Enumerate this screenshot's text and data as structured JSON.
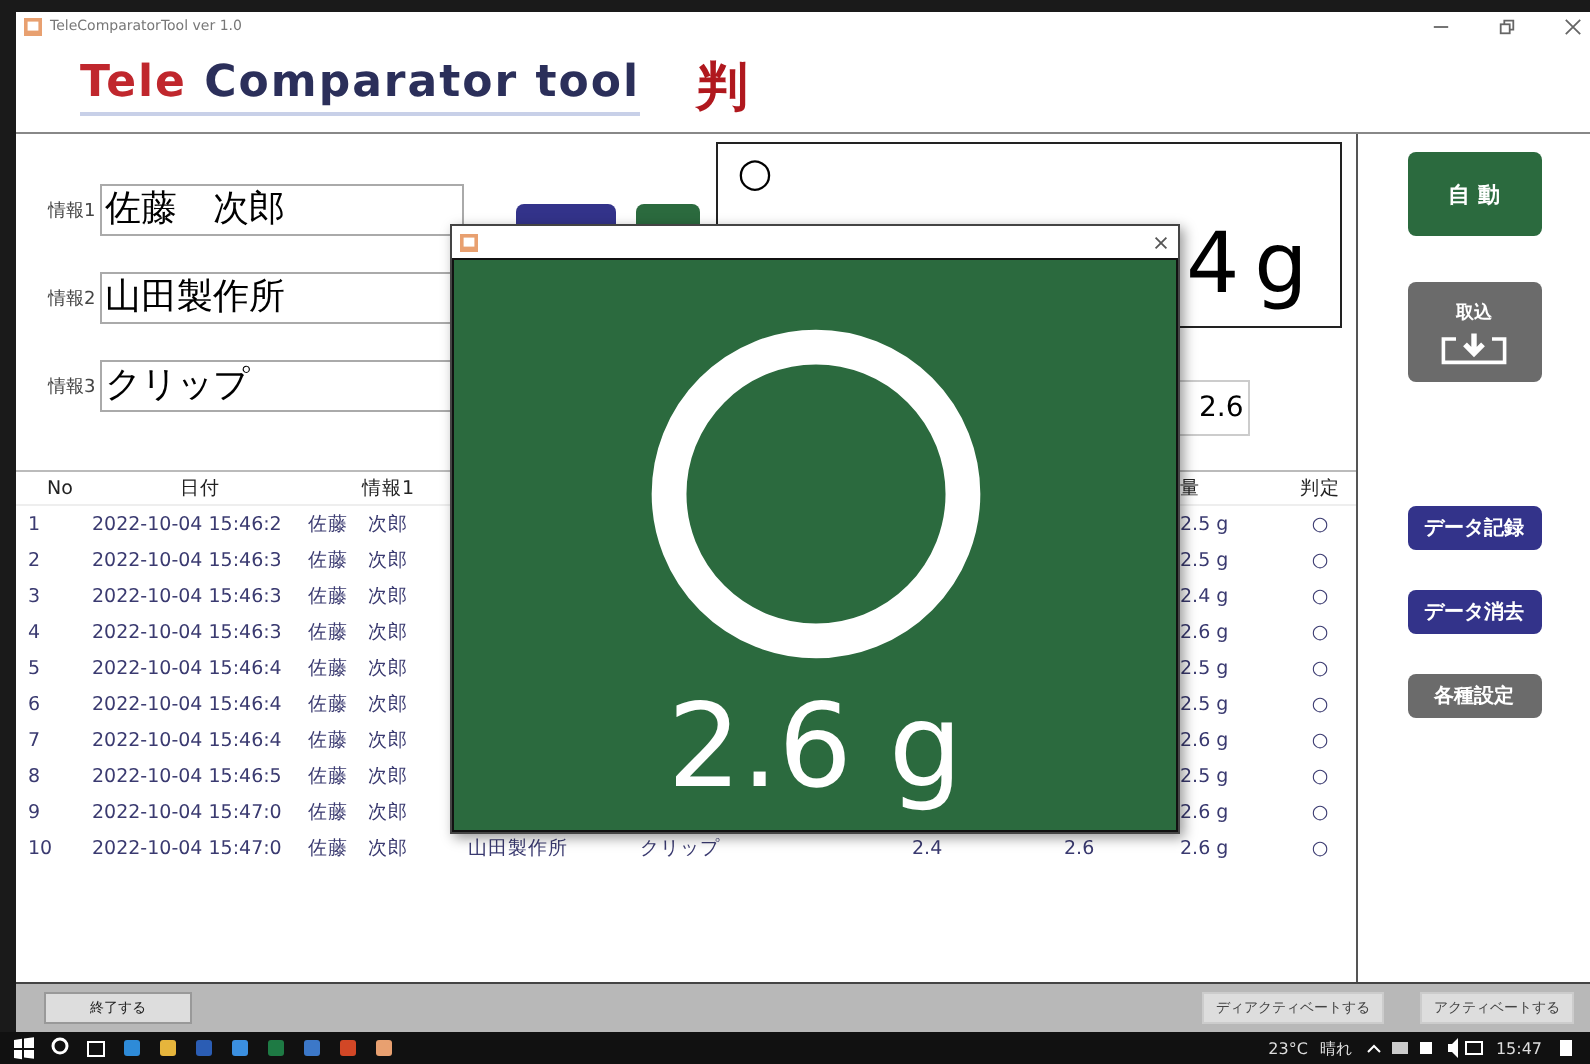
{
  "window": {
    "title": "TeleComparatorTool ver 1.0"
  },
  "logo": {
    "part1": "Tele",
    "part2": "Comparator tool",
    "mark": "判"
  },
  "fields": [
    {
      "label": "情報1",
      "value": "佐藤　次郎"
    },
    {
      "label": "情報2",
      "value": "山田製作所"
    },
    {
      "label": "情報3",
      "value": "クリップ"
    }
  ],
  "display": {
    "judgement": "○",
    "value": "4 g"
  },
  "small_field": {
    "value": "2.6"
  },
  "table": {
    "columns": [
      "No",
      "日付",
      "情報1",
      null,
      null,
      null,
      null,
      "量",
      "判定"
    ],
    "rows": [
      {
        "cells": [
          "1",
          "2022-10-04 15:46:2",
          "佐藤　次郎",
          null,
          null,
          null,
          null,
          "2.5 g",
          "○"
        ]
      },
      {
        "cells": [
          "2",
          "2022-10-04 15:46:3",
          "佐藤　次郎",
          null,
          null,
          null,
          null,
          "2.5 g",
          "○"
        ]
      },
      {
        "cells": [
          "3",
          "2022-10-04 15:46:3",
          "佐藤　次郎",
          null,
          null,
          null,
          null,
          "2.4 g",
          "○"
        ]
      },
      {
        "cells": [
          "4",
          "2022-10-04 15:46:3",
          "佐藤　次郎",
          null,
          null,
          null,
          null,
          "2.6 g",
          "○"
        ]
      },
      {
        "cells": [
          "5",
          "2022-10-04 15:46:4",
          "佐藤　次郎",
          null,
          null,
          null,
          null,
          "2.5 g",
          "○"
        ]
      },
      {
        "cells": [
          "6",
          "2022-10-04 15:46:4",
          "佐藤　次郎",
          null,
          null,
          null,
          null,
          "2.5 g",
          "○"
        ]
      },
      {
        "cells": [
          "7",
          "2022-10-04 15:46:4",
          "佐藤　次郎",
          null,
          null,
          null,
          null,
          "2.6 g",
          "○"
        ]
      },
      {
        "cells": [
          "8",
          "2022-10-04 15:46:5",
          "佐藤　次郎",
          null,
          null,
          null,
          null,
          "2.5 g",
          "○"
        ]
      },
      {
        "cells": [
          "9",
          "2022-10-04 15:47:0",
          "佐藤　次郎",
          null,
          null,
          null,
          null,
          "2.6 g",
          "○"
        ]
      },
      {
        "cells": [
          "10",
          "2022-10-04 15:47:0",
          "佐藤　次郎",
          "山田製作所",
          "クリップ",
          "2.4",
          "2.6",
          "2.6 g",
          "○"
        ]
      }
    ]
  },
  "side_buttons": [
    {
      "label": "自 動",
      "kind": "auto"
    },
    {
      "label": "取込",
      "kind": "import"
    },
    {
      "label": "データ記録",
      "kind": "action"
    },
    {
      "label": "データ消去",
      "kind": "action"
    },
    {
      "label": "各種設定",
      "kind": "settings"
    }
  ],
  "footer": {
    "exit": "終了する",
    "deactivate": "ディアクティベートする",
    "activate": "アクティベートする"
  },
  "popup": {
    "value": "2.6 g"
  },
  "taskbar": {
    "temperature": "23°C",
    "weather": "晴れ",
    "time": "15:47"
  }
}
